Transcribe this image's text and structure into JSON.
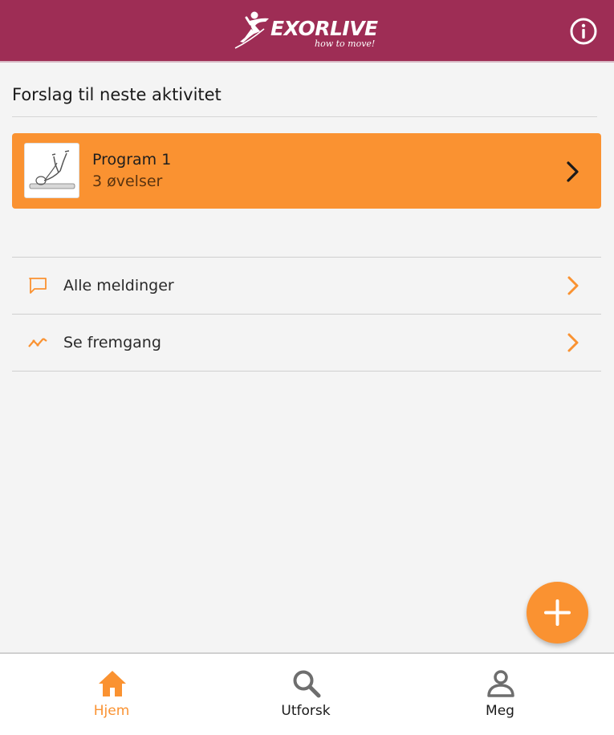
{
  "header": {
    "logo_text": "EXORLIVE",
    "logo_tagline": "how to move!",
    "info_icon": "info-circle-icon",
    "background": "#9e2d55"
  },
  "main": {
    "section_title": "Forslag til neste aktivitet",
    "suggestion_card": {
      "title": "Program 1",
      "subtitle": "3 øvelser",
      "background": "#fa9231",
      "thumbnail": "exercise-illustration",
      "chevron": "chevron-right-icon"
    },
    "menu": [
      {
        "label": "Alle meldinger",
        "icon": "message-icon",
        "chevron": "chevron-right-icon"
      },
      {
        "label": "Se fremgang",
        "icon": "trend-line-icon",
        "chevron": "chevron-right-icon"
      }
    ],
    "fab": {
      "icon": "plus-icon",
      "color": "#fa9231"
    }
  },
  "bottom_nav": {
    "items": [
      {
        "label": "Hjem",
        "icon": "home-icon",
        "active": true
      },
      {
        "label": "Utforsk",
        "icon": "search-icon",
        "active": false
      },
      {
        "label": "Meg",
        "icon": "user-icon",
        "active": false
      }
    ],
    "active_color": "#fa9231",
    "inactive_icon_color": "#6e6e6e"
  }
}
